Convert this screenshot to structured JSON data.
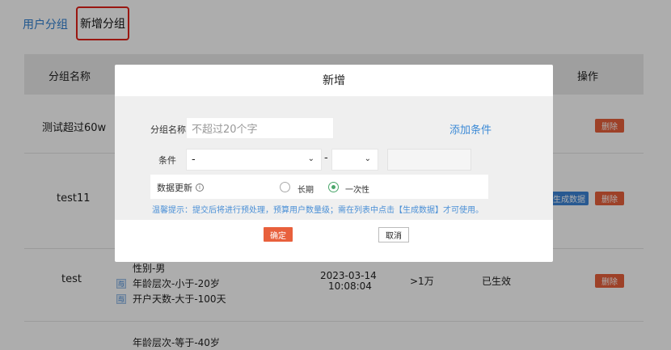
{
  "tabs": {
    "user_group": "用户分组",
    "add_group": "新增分组"
  },
  "table": {
    "headers": {
      "name": "分组名称",
      "actions": "操作"
    },
    "rows": [
      {
        "name": "测试超过60w",
        "delete": "删除"
      },
      {
        "name": "test11",
        "generate": "生成数据",
        "delete": "删除"
      },
      {
        "name": "test",
        "cond_title": "性别-男",
        "cond_badge": "与",
        "cond_1": "年龄层次-小于-20岁",
        "cond_2": "开户天数-大于-100天",
        "date": "2023-03-14",
        "time": "10:08:04",
        "count": ">1万",
        "status": "已生效",
        "delete": "删除"
      },
      {
        "cond_title": "年龄层次-等于-40岁"
      }
    ]
  },
  "modal": {
    "title": "新增",
    "group_name_label": "分组名称",
    "group_name_placeholder": "不超过20个字",
    "add_condition": "添加条件",
    "condition_label": "条件",
    "select_1_value": "-",
    "dash": "-",
    "update_label": "数据更新",
    "info_icon_text": "i",
    "option_long": "长期",
    "option_once": "一次性",
    "hint": "温馨提示：提交后将进行预处理，预算用户数量级；需在列表中点击【生成数据】才可使用。",
    "confirm": "确定",
    "cancel": "取消"
  },
  "colors": {
    "accent": "#e8603c",
    "link": "#3c8ad6",
    "radio": "#4aa66a",
    "highlight_border": "#e2231a"
  }
}
